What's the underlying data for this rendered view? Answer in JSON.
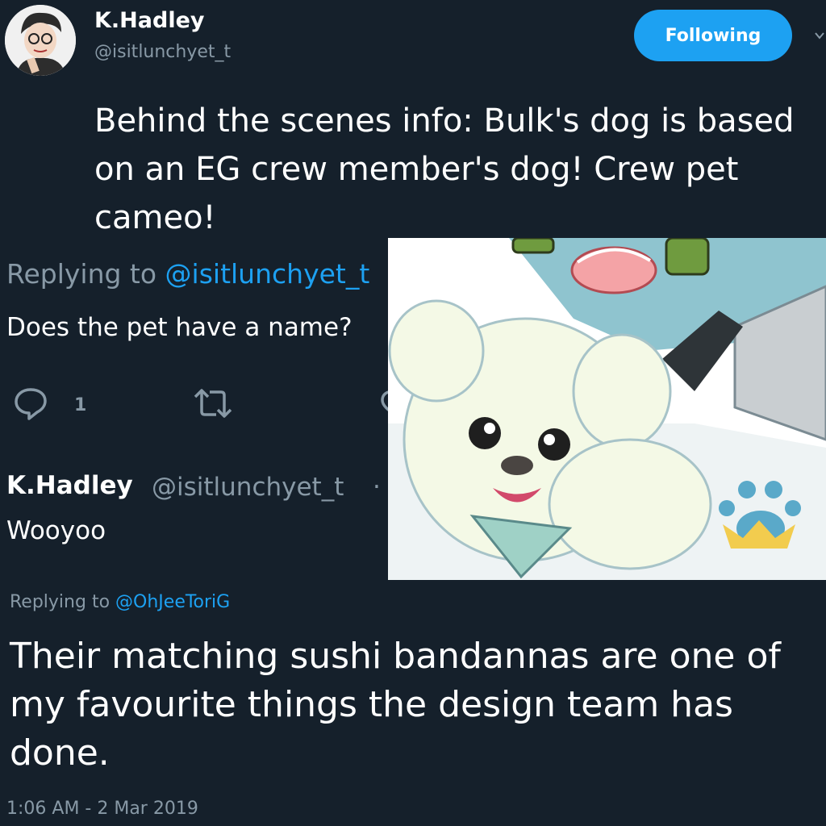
{
  "tweet": {
    "author_name": "K.Hadley",
    "author_handle": "@isitlunchyet_t",
    "follow_label": "Following",
    "text": "Behind the scenes info: Bulk's dog is based on an EG crew member's dog! Crew pet cameo!"
  },
  "reply_1": {
    "replying_prefix": "Replying to ",
    "replying_handle": "@isitlunchyet_t",
    "text": "Does the pet have a name?",
    "reply_count": "1"
  },
  "reply_2": {
    "author_name": "K.Hadley",
    "author_handle": "@isitlunchyet_t",
    "separator": "·",
    "text": "Wooyoo"
  },
  "reply_3": {
    "replying_prefix": "Replying to ",
    "replying_handle": "@OhJeeToriG",
    "text": "Their matching  sushi bandannas are one of my favourite things the design team has done.",
    "timestamp": "1:06 AM - 2 Mar 2019"
  },
  "icons": {
    "comment": "comment-icon",
    "retweet": "retweet-icon",
    "like": "heart-icon",
    "chevron": "chevron-down-icon"
  },
  "colors": {
    "background": "#15202b",
    "accent": "#1da1f2",
    "muted": "#8899a6"
  }
}
